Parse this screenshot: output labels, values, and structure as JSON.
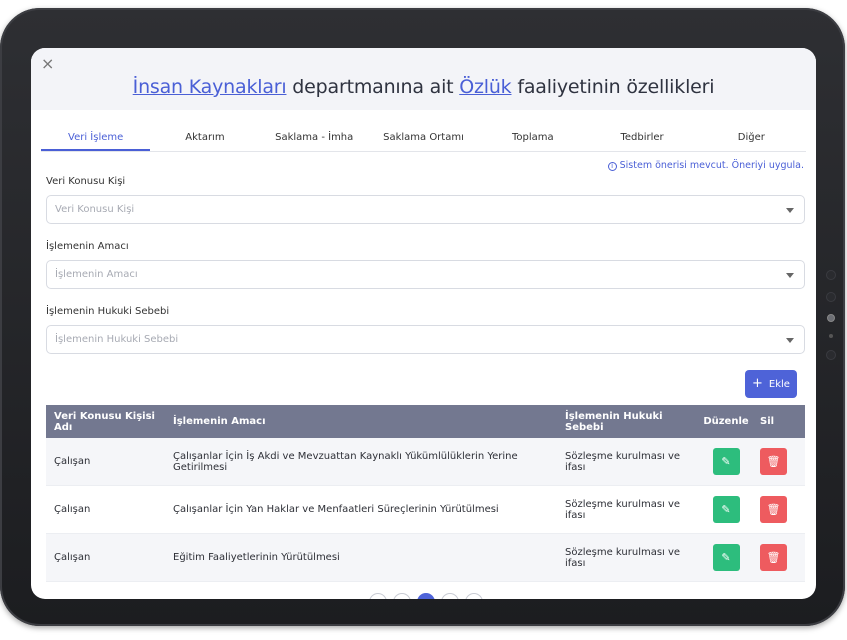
{
  "header": {
    "close_symbol": "×",
    "title_parts": {
      "department": "İnsan Kaynakları",
      "middle": " departmanına ait ",
      "activity": "Özlük",
      "end": " faaliyetinin özellikleri"
    }
  },
  "tabs": [
    {
      "label": "Veri İşleme",
      "active": true
    },
    {
      "label": "Aktarım"
    },
    {
      "label": "Saklama - İmha"
    },
    {
      "label": "Saklama Ortamı"
    },
    {
      "label": "Toplama"
    },
    {
      "label": "Tedbirler"
    },
    {
      "label": "Diğer"
    }
  ],
  "suggestion": {
    "icon": "info-icon",
    "text": "Sistem önerisi mevcut. Öneriyi uygula."
  },
  "form": {
    "subject": {
      "label": "Veri Konusu Kişi",
      "placeholder": "Veri Konusu Kişi"
    },
    "purpose": {
      "label": "İşlemenin Amacı",
      "placeholder": "İşlemenin Amacı"
    },
    "legal": {
      "label": "İşlemenin Hukuki Sebebi",
      "placeholder": "İşlemenin Hukuki Sebebi"
    }
  },
  "add_button": {
    "label": "Ekle",
    "icon": "plus-icon"
  },
  "table": {
    "headers": [
      "Veri Konusu Kişisi Adı",
      "İşlemenin Amacı",
      "İşlemenin Hukuki Sebebi",
      "Düzenle",
      "Sil"
    ],
    "rows": [
      {
        "subject": "Çalışan",
        "purpose": "Çalışanlar İçin İş Akdi ve Mevzuattan Kaynaklı Yükümlülüklerin Yerine Getirilmesi",
        "legal": "Sözleşme kurulması ve ifası"
      },
      {
        "subject": "Çalışan",
        "purpose": "Çalışanlar İçin Yan Haklar ve Menfaatleri Süreçlerinin Yürütülmesi",
        "legal": "Sözleşme kurulması ve ifası"
      },
      {
        "subject": "Çalışan",
        "purpose": "Eğitim Faaliyetlerinin Yürütülmesi",
        "legal": "Sözleşme kurulması ve ifası"
      }
    ],
    "edit_icon": "pencil-icon",
    "delete_icon": "trash-icon"
  },
  "colors": {
    "accent": "#4e63d8",
    "edit": "#2dbd7d",
    "delete": "#ee5b5f",
    "table_header": "#737890"
  }
}
